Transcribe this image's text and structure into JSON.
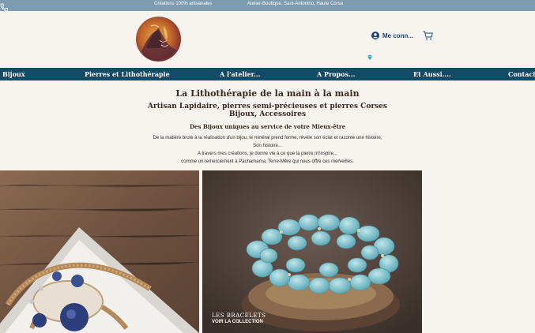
{
  "topbar": {
    "tagline": "Créations 100% artisanales",
    "location": "Atelier-Boutique, Sant-Antonino, Haute Corse",
    "phone_icon": "phone-icon"
  },
  "header": {
    "logo": "brand-logo",
    "login_label": "Me conn...",
    "login_icon": "user-icon",
    "cart_icon": "cart-icon",
    "badge_icon": "diamond-icon"
  },
  "nav": {
    "items": [
      "Bijoux",
      "Pierres et Lithothérapie",
      "A l'atelier...",
      "A Propos...",
      "Et Aussi....",
      "Contact"
    ]
  },
  "hero": {
    "title": "La Lithothérapie de la main à la main",
    "subtitle_1": "Artisan Lapidaire, pierres semi-précieuses et pierres Corses",
    "subtitle_2": "Bijoux, Accessoires",
    "subtitle_3": "Des Bijoux uniques au service de votre Mieux-être",
    "paragraph_1": "De la matière brute à la réalisation d'un bijou, le minéral prend forme, révèle son éclat et raconte une histoire,",
    "paragraph_2": "Son histoire...",
    "paragraph_3": "A travers mes créations, je donne vie à ce que la pierre m'inspire,..",
    "paragraph_4": "comme un remerciement à Pachamama, Terre-Mère qui nous offre ces merveilles."
  },
  "gallery": {
    "right_title": "LES BRACELETS",
    "right_link": "VOIR LA COLLECTION"
  },
  "colors": {
    "topbar": "#7d9caf",
    "nav": "#134a66",
    "background": "#f7f3ef",
    "accent": "#1d4670"
  }
}
